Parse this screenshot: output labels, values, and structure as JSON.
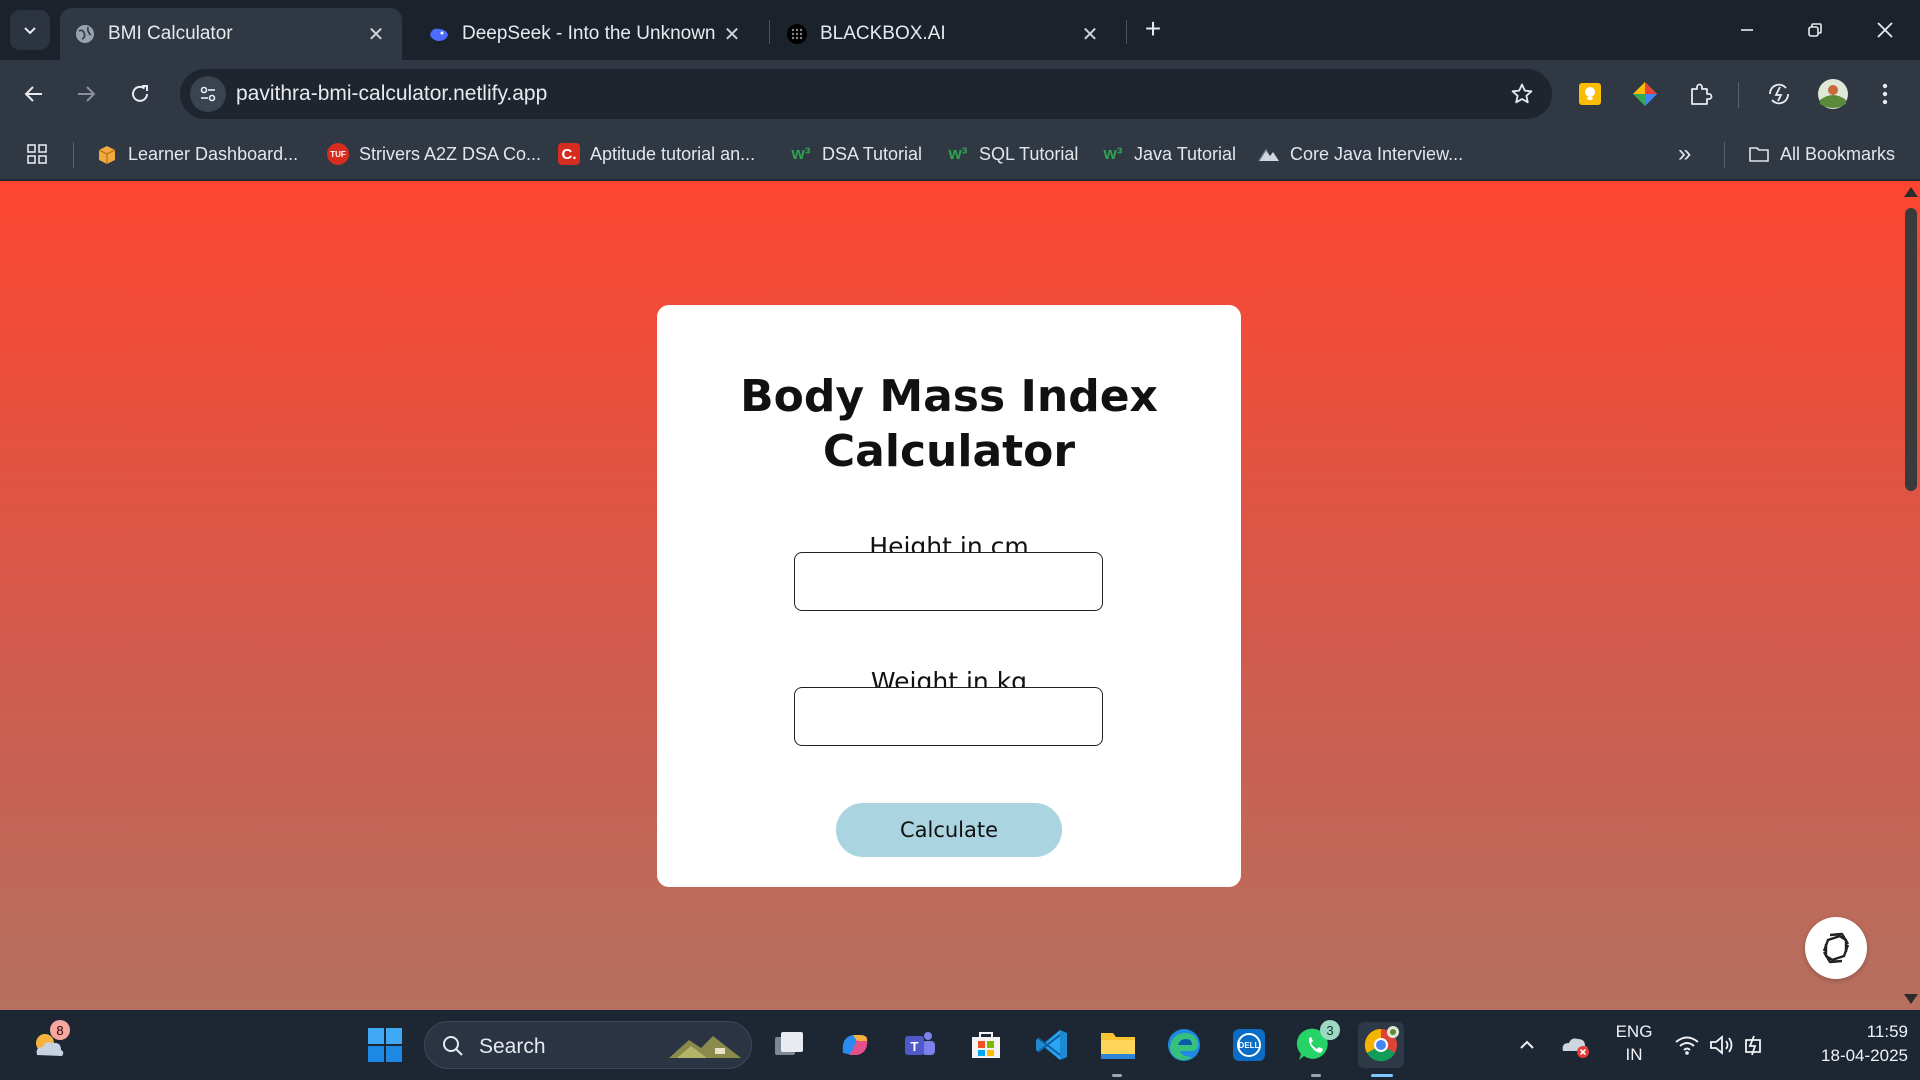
{
  "browser": {
    "tabs": [
      {
        "title": "BMI Calculator",
        "active": true
      },
      {
        "title": "DeepSeek - Into the Unknown",
        "active": false
      },
      {
        "title": "BLACKBOX.AI",
        "active": false
      }
    ],
    "url": "pavithra-bmi-calculator.netlify.app",
    "bookmarks": [
      {
        "label": "Learner Dashboard..."
      },
      {
        "label": "Strivers A2Z DSA Co..."
      },
      {
        "label": "Aptitude tutorial an..."
      },
      {
        "label": "DSA Tutorial"
      },
      {
        "label": "SQL Tutorial"
      },
      {
        "label": "Java Tutorial"
      },
      {
        "label": "Core Java Interview..."
      }
    ],
    "all_bookmarks_label": "All Bookmarks",
    "overflow_label": "»"
  },
  "page": {
    "title": "Body Mass Index Calculator",
    "height_label": "Height in cm",
    "height_value": "",
    "weight_label": "Weight in kg",
    "weight_value": "",
    "calculate_label": "Calculate",
    "gradient_top": "#fd4630",
    "gradient_bottom": "#b5705f",
    "button_color": "#a9d4e0"
  },
  "taskbar": {
    "search_label": "Search",
    "weather_badge": "8",
    "whatsapp_badge": "3",
    "lang_line1": "ENG",
    "lang_line2": "IN",
    "time": "11:59",
    "date": "18-04-2025"
  }
}
